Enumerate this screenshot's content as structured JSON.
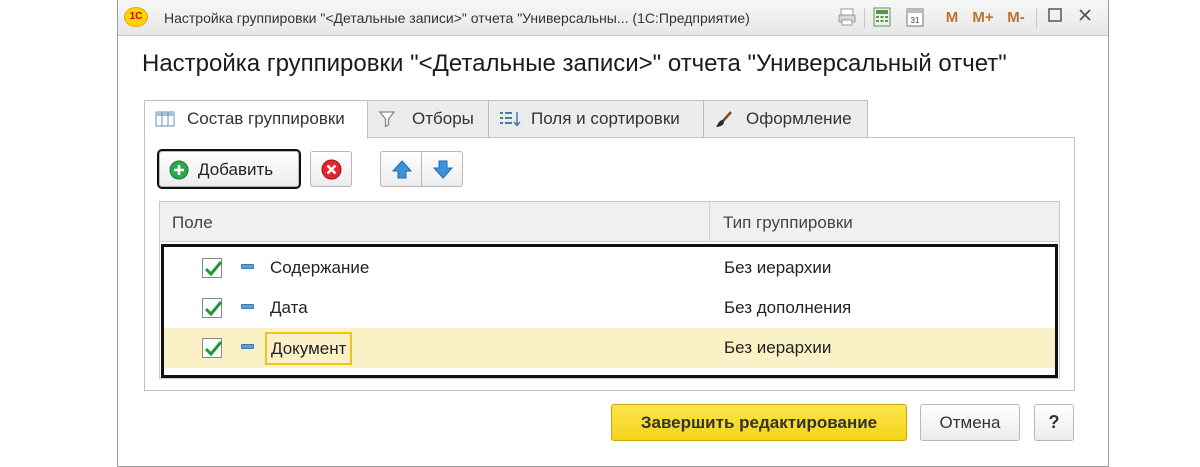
{
  "window": {
    "title": "Настройка группировки \"<Детальные записи>\" отчета \"Универсальны... (1С:Предприятие)",
    "logo_text": "1С",
    "memory_buttons": [
      "M",
      "M+",
      "M-"
    ]
  },
  "form": {
    "heading": "Настройка группировки \"<Детальные записи>\" отчета \"Универсальный отчет\""
  },
  "tabs": [
    {
      "label": "Состав группировки",
      "icon": "grouping-icon",
      "active": true
    },
    {
      "label": "Отборы",
      "icon": "filter-icon",
      "active": false
    },
    {
      "label": "Поля и сортировки",
      "icon": "sort-fields-icon",
      "active": false
    },
    {
      "label": "Оформление",
      "icon": "brush-icon",
      "active": false
    }
  ],
  "toolbar": {
    "add_label": "Добавить"
  },
  "grid": {
    "columns": [
      "Поле",
      "Тип группировки"
    ],
    "rows": [
      {
        "field": "Содержание",
        "group_type": "Без иерархии",
        "checked": true
      },
      {
        "field": "Дата",
        "group_type": "Без дополнения",
        "checked": true
      },
      {
        "field": "Документ",
        "group_type": "Без иерархии",
        "checked": true,
        "selected": true
      }
    ]
  },
  "footer": {
    "finish_label": "Завершить редактирование",
    "cancel_label": "Отмена",
    "help_label": "?"
  },
  "colors": {
    "accent_yellow": "#f4d31b",
    "selected_row": "#fbf1c6",
    "check_green": "#1a9a3a"
  }
}
